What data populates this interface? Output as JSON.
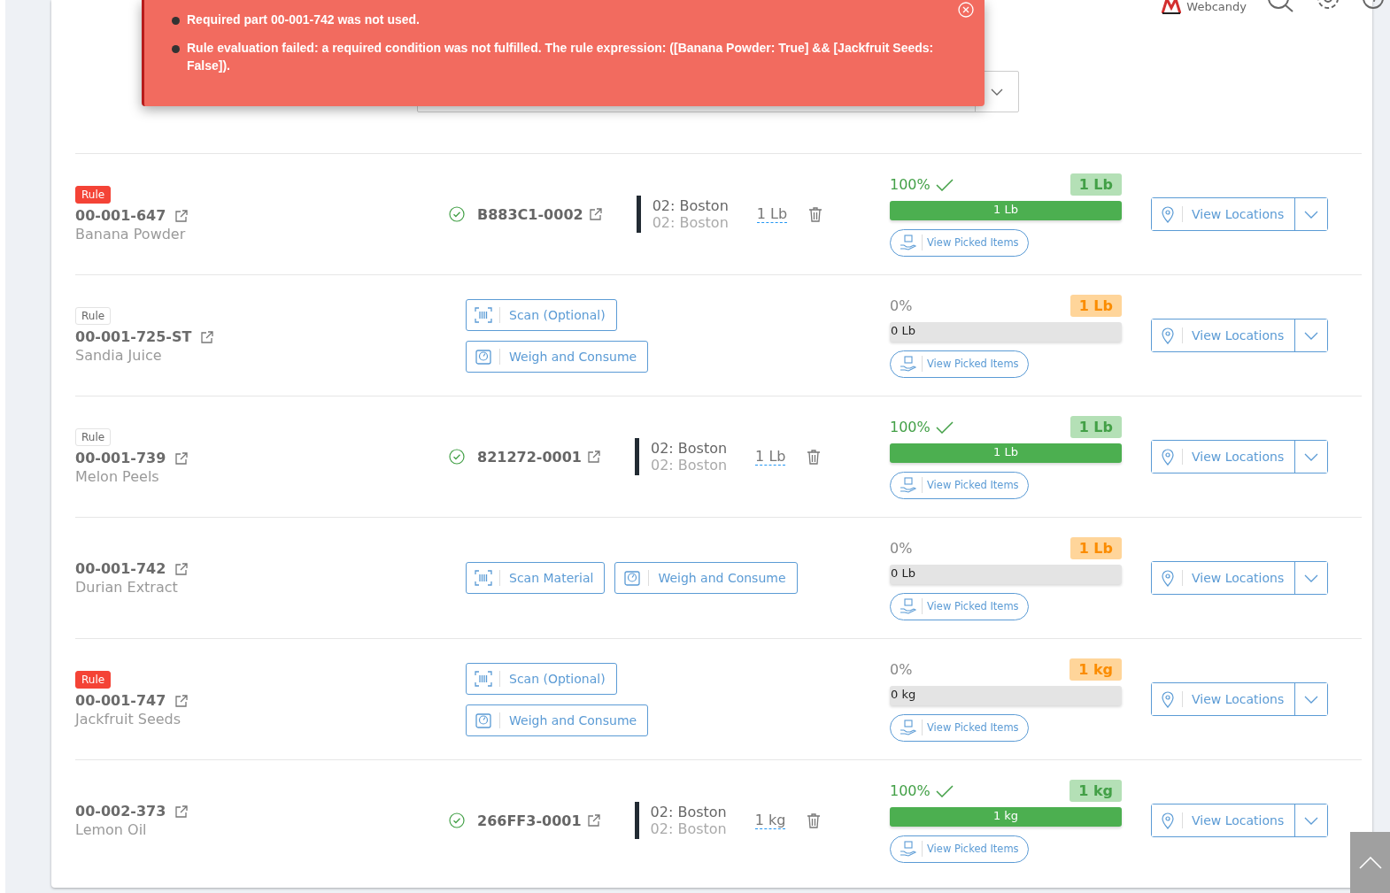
{
  "header": {
    "brand": "Webcandy"
  },
  "toast": {
    "messages": [
      "Required part 00-001-742 was not used.",
      "Rule evaluation failed: a required condition was not fulfilled. The rule expression: ([Banana Powder: True] && [Jackfruit Seeds: False])."
    ]
  },
  "rows": [
    {
      "part": "00-001-647",
      "name": "Banana Powder",
      "rule": {
        "label": "Rule",
        "failed": true
      },
      "kind": "consumed",
      "lot": "B883C1-0002",
      "locations": [
        "02: Boston",
        "02: Boston"
      ],
      "qty": "1 Lb",
      "percent": "100%",
      "complete": true,
      "required": "1 Lb",
      "level": 1,
      "bar_label": "1 Lb",
      "picked": "View Picked Items",
      "view_locations": "View Locations"
    },
    {
      "part": "00-001-725-ST",
      "name": "Sandia Juice",
      "rule": {
        "label": "Rule",
        "failed": false
      },
      "kind": "actions",
      "stacked": true,
      "actions": [
        {
          "kind": "scan",
          "label": "Scan (Optional)"
        },
        {
          "kind": "weigh",
          "label": "Weigh and Consume"
        }
      ],
      "percent": "0%",
      "complete": false,
      "required": "1 Lb",
      "level": 0,
      "bar_label": "0 Lb",
      "picked": "View Picked Items",
      "view_locations": "View Locations"
    },
    {
      "part": "00-001-739",
      "name": "Melon Peels",
      "rule": {
        "label": "Rule",
        "failed": false
      },
      "kind": "consumed",
      "lot": "821272-0001",
      "locations": [
        "02: Boston",
        "02: Boston"
      ],
      "qty": "1 Lb",
      "percent": "100%",
      "complete": true,
      "required": "1 Lb",
      "level": 1,
      "bar_label": "1 Lb",
      "picked": "View Picked Items",
      "view_locations": "View Locations"
    },
    {
      "part": "00-001-742",
      "name": "Durian Extract",
      "kind": "actions",
      "stacked": false,
      "actions": [
        {
          "kind": "scan",
          "label": "Scan Material"
        },
        {
          "kind": "weigh",
          "label": "Weigh and Consume"
        }
      ],
      "percent": "0%",
      "complete": false,
      "required": "1 Lb",
      "level": 0,
      "bar_label": "0 Lb",
      "picked": "View Picked Items",
      "view_locations": "View Locations"
    },
    {
      "part": "00-001-747",
      "name": "Jackfruit Seeds",
      "rule": {
        "label": "Rule",
        "failed": true
      },
      "kind": "actions",
      "stacked": true,
      "actions": [
        {
          "kind": "scan",
          "label": "Scan (Optional)"
        },
        {
          "kind": "weigh",
          "label": "Weigh and Consume"
        }
      ],
      "percent": "0%",
      "complete": false,
      "required": "1 kg",
      "level": 0,
      "bar_label": "0 kg",
      "picked": "View Picked Items",
      "view_locations": "View Locations"
    },
    {
      "part": "00-002-373",
      "name": "Lemon Oil",
      "kind": "consumed",
      "lot": "266FF3-0001",
      "locations": [
        "02: Boston",
        "02: Boston"
      ],
      "qty": "1 kg",
      "percent": "100%",
      "complete": true,
      "required": "1 kg",
      "level": 1,
      "bar_label": "1 kg",
      "picked": "View Picked Items",
      "view_locations": "View Locations"
    }
  ]
}
